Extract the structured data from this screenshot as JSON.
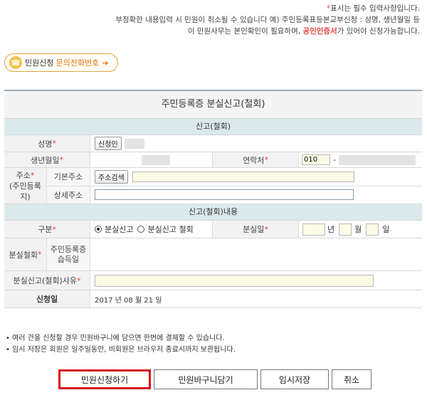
{
  "notice": {
    "line1_mark": "*",
    "line1": "표시는 필수 입력사항입니다.",
    "line2": "부정확한 내용입력 시 민원이 취소될 수 있습니다  예) 주민등록표등본교부신청 : 성명, 생년월일 등",
    "line3_pre": "이 민원사무는 본인확인이 필요하며, ",
    "line3_cert": "공인인증서",
    "line3_post": "가 있어야 신청가능합니다."
  },
  "inquiry": {
    "icon": "phone-icon",
    "label1": "민원신청",
    "label2": "문의전화번호",
    "arrow": "➔"
  },
  "form": {
    "title": "주민등록증 분실신고(철회)",
    "section1": "신고(철회)",
    "name_label": "성명",
    "name_button": "신청인",
    "birth_label": "생년월일",
    "contact_label": "연락처",
    "phone_prefix": "010",
    "phone_sep": "-",
    "address_label": "주소",
    "address_sub": "(주민등록지)",
    "basic_address_label": "기본주소",
    "address_search_button": "주소검색",
    "detail_address_label": "상세주소",
    "section2": "신고(철회)내용",
    "type_label": "구분",
    "opt_lost": "분실신고",
    "opt_withdraw": "분실신고 철회",
    "lost_date_label": "분실일",
    "year": "년",
    "month": "월",
    "day": "일",
    "withdraw_label": "분실철회",
    "found_date_label1": "주민등록증",
    "found_date_label2": "습득일",
    "reason_label": "분실신고(철회)사유",
    "apply_date_label": "신청일",
    "apply_date": "2017  년 08  월 21  일",
    "req_mark": "*"
  },
  "bullets": [
    "• 여러 건을 신청할 경우 민원바구니에 담으면 한번에 결제할 수 있습니다.",
    "• 임시 저장은 회원은 일주일동안, 비회원은 브라우저 종료시까지 보관됩니다."
  ],
  "buttons": {
    "apply": "민원신청하기",
    "basket": "민원바구니담기",
    "temp_save": "임시저장",
    "cancel": "취소"
  }
}
